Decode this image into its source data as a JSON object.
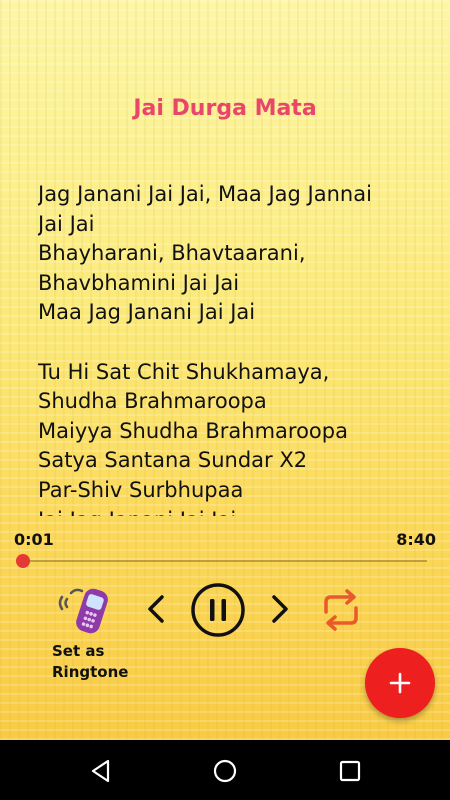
{
  "song": {
    "title": "Jai Durga Mata",
    "lyrics": "Jag Janani Jai Jai, Maa Jag Jannai\nJai Jai\nBhayharani, Bhavtaarani,\nBhavbhamini Jai Jai\nMaa Jag Janani Jai Jai\n\nTu Hi Sat Chit Shukhamaya,\nShudha Brahmaroopa\nMaiyya Shudha Brahmaroopa\nSatya Santana Sundar X2\nPar-Shiv Surbhupaa\nJai Jag Janani Jai Jai"
  },
  "player": {
    "current_time": "0:01",
    "total_time": "8:40",
    "progress_fraction": 0.002,
    "ringtone_label": "Set as\nRingtone"
  },
  "icons": {
    "ringtone": "phone-ringing-icon",
    "prev": "chevron-left-icon",
    "pause": "pause-circle-icon",
    "next": "chevron-right-icon",
    "repeat": "repeat-icon",
    "fab": "plus-icon",
    "nav_back": "back-triangle-icon",
    "nav_home": "home-circle-icon",
    "nav_recents": "recents-square-icon"
  },
  "colors": {
    "title": "#e8466b",
    "accent": "#e53935",
    "fab": "#ee1f1f",
    "repeat": "#e85a2a"
  }
}
